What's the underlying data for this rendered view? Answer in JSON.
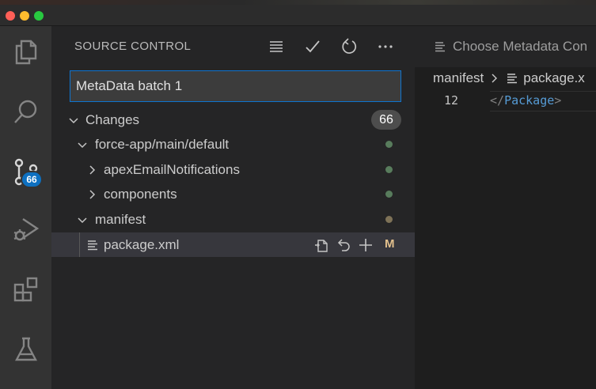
{
  "window": {
    "traffic_lights": [
      "close",
      "minimize",
      "maximize"
    ]
  },
  "activity_bar": {
    "items": [
      {
        "name": "explorer",
        "icon": "files-icon"
      },
      {
        "name": "search",
        "icon": "search-icon"
      },
      {
        "name": "source-control",
        "icon": "source-control-icon",
        "badge": "66"
      },
      {
        "name": "run-debug",
        "icon": "run-debug-icon"
      },
      {
        "name": "extensions",
        "icon": "extensions-icon"
      },
      {
        "name": "testing",
        "icon": "flask-icon"
      }
    ]
  },
  "sidebar": {
    "title": "SOURCE CONTROL",
    "actions": [
      "view-as-list-icon",
      "commit-check-icon",
      "refresh-icon",
      "more-icon"
    ],
    "commit_message": {
      "value": "MetaData batch 1"
    },
    "changes": {
      "label": "Changes",
      "count": "66"
    },
    "tree": [
      {
        "label": "force-app/main/default",
        "status": "green"
      },
      {
        "label": "apexEmailNotifications",
        "status": "green"
      },
      {
        "label": "components",
        "status": "green"
      },
      {
        "label": "manifest",
        "status": "brown"
      },
      {
        "label": "package.xml",
        "status": "M",
        "selected": true
      }
    ],
    "inline_actions": [
      "open-file-icon",
      "discard-changes-icon",
      "stage-changes-icon"
    ]
  },
  "editor": {
    "tab_title": "Choose Metadata Con",
    "breadcrumbs": [
      "manifest",
      "package.x"
    ],
    "code": {
      "line_number": "12",
      "open": "</",
      "tag": "Package",
      "close": ">"
    }
  },
  "colors": {
    "accent": "#0e70c0",
    "modified": "#e2c08d",
    "added_dot": "#587c5c",
    "folder_dot": "#7e7257"
  }
}
